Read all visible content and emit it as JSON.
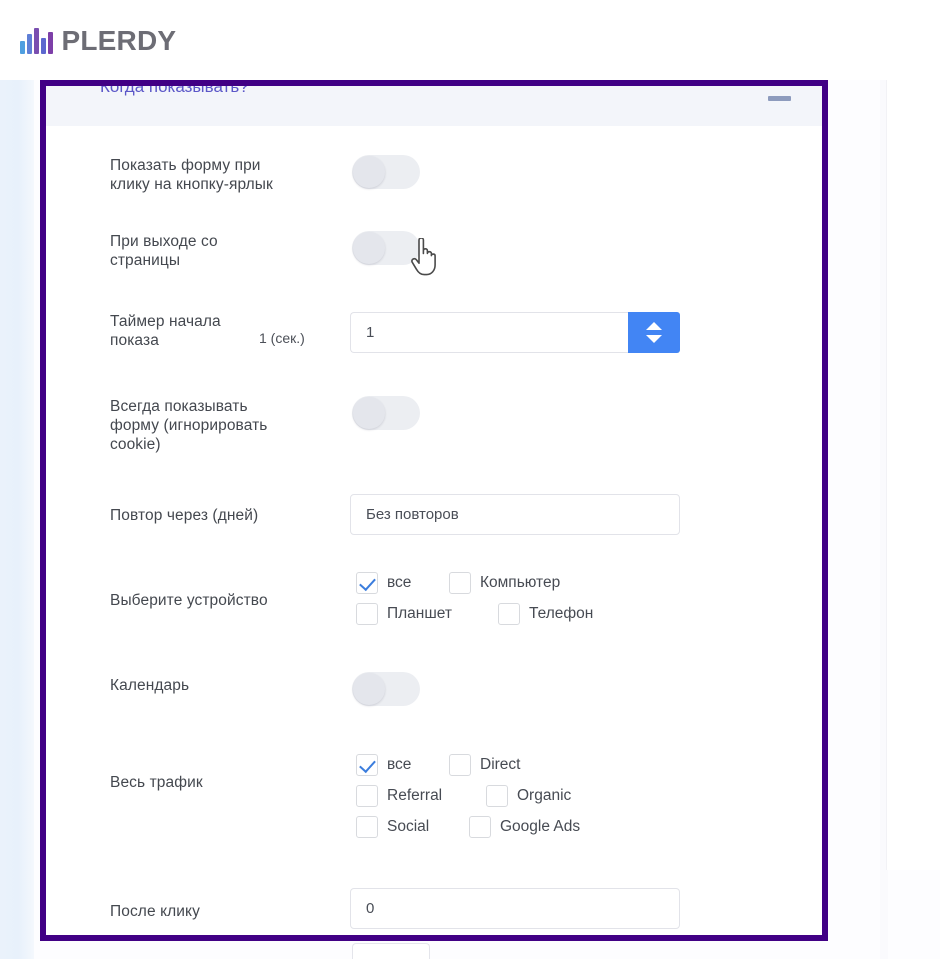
{
  "brand": {
    "name": "PLERDY",
    "logo_icon": "bar-chart-logo-icon"
  },
  "panel": {
    "title": "Когда показывать?",
    "collapse_icon": "minimize-icon",
    "accent_color": "#410085",
    "title_color": "#5b57c8",
    "spinner_color": "#4285f4",
    "check_color": "#3b7ddd"
  },
  "rows": {
    "show_on_tab_click": {
      "label": "Показать форму при\nклику на кнопку-ярлык",
      "label_line1": "Показать форму при",
      "label_line2": "клику на кнопку-ярлык",
      "toggle_state": "off"
    },
    "exit_intent": {
      "label_line1": "При выходе со",
      "label_line2": "страницы",
      "toggle_state": "off"
    },
    "start_timer": {
      "label_line1": "Таймер начала",
      "label_line2": "показа",
      "unit": "1 (сек.)",
      "value": "1",
      "stepper_up_icon": "triangle-up-icon",
      "stepper_down_icon": "triangle-down-icon"
    },
    "always_show": {
      "label_line1": "Всегда показывать",
      "label_line2": "форму (игнорировать",
      "label_line3": "cookie)",
      "toggle_state": "off"
    },
    "repeat_days": {
      "label": "Повтор через (дней)",
      "value": "Без повторов"
    },
    "device": {
      "label": "Выберите устройство",
      "options": [
        {
          "label": "все",
          "checked": true
        },
        {
          "label": "Компьютер",
          "checked": false
        },
        {
          "label": "Планшет",
          "checked": false
        },
        {
          "label": "Телефон",
          "checked": false
        }
      ]
    },
    "calendar": {
      "label": "Календарь",
      "toggle_state": "off"
    },
    "traffic": {
      "label": "Весь трафик",
      "options": [
        {
          "label": "все",
          "checked": true
        },
        {
          "label": "Direct",
          "checked": false
        },
        {
          "label": "Referral",
          "checked": false
        },
        {
          "label": "Organic",
          "checked": false
        },
        {
          "label": "Social",
          "checked": false
        },
        {
          "label": "Google Ads",
          "checked": false
        }
      ]
    },
    "after_click": {
      "label": "После клику",
      "value": "0"
    }
  },
  "cursor": {
    "type": "pointer-hand-cursor"
  }
}
